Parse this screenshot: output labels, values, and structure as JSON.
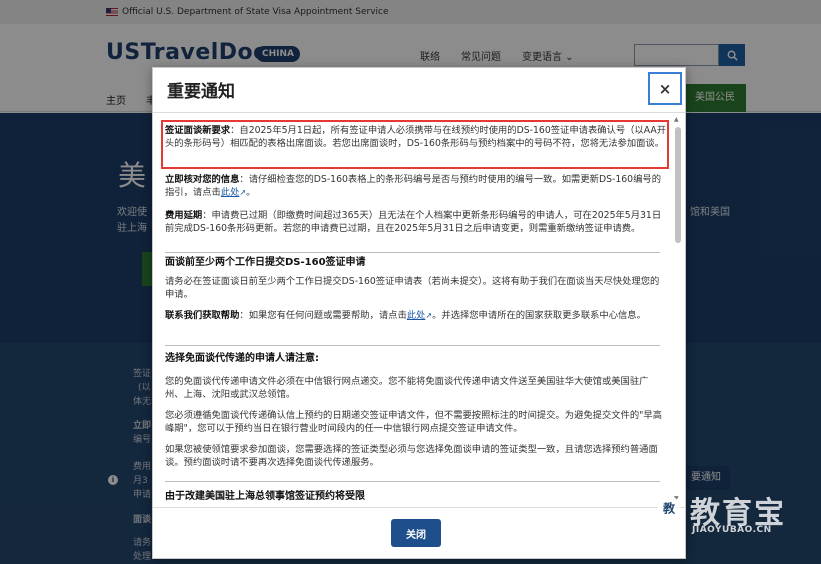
{
  "background": {
    "gov_banner": "Official U.S. Department of State Visa Appointment Service",
    "brand_name": "USTravelDocs",
    "brand_badge": "CHINA",
    "top_nav": [
      "联络",
      "常见问题",
      "变更语言 ⌄"
    ],
    "main_nav_home": "主页",
    "main_nav_partial": "丰",
    "main_nav_right": "美国公民",
    "hero_title": "美",
    "hero_left_lines": [
      "欢迎使",
      "驻上海"
    ],
    "hero_right_lines": [
      "馆和美国"
    ],
    "lower_fragments": [
      "签证",
      "(以",
      "体无",
      "立即",
      "编号",
      "费用",
      "月3",
      "申请",
      "面谈",
      "请务",
      "处理"
    ],
    "notice_button_partial": "要通知"
  },
  "modal": {
    "title": "重要通知",
    "close_label": "×",
    "paragraphs": [
      {
        "lead": "签证面谈新要求",
        "text": "：自2025年5月1日起，所有签证申请人必须携带与在线预约时使用的DS-160签证申请表确认号（以AA开头的条形码号）相匹配的表格出席面谈。若您出席面谈时，DS-160条形码与预约档案中的号码不符，您将无法参加面谈。"
      },
      {
        "lead": "立即核对您的信息",
        "text": "：请仔细检查您的DS-160表格上的条形码编号是否与预约时使用的编号一致。如需更新DS-160编号的指引，请点击",
        "link": "此处",
        "tail": "。"
      },
      {
        "lead": "费用延期",
        "text": "：申请费已过期（即缴费时间超过365天）且无法在个人档案中更新条形码编号的申请人，可在2025年5月31日前完成DS-160条形码更新。若您的申请费已过期，且在2025年5月31日之后申请变更，则需重新缴纳签证申请费。"
      }
    ],
    "section_submit_head": "面谈前至少两个工作日提交DS-160签证申请",
    "section_submit_text": "请务必在签证面谈日前至少两个工作日提交DS-160签证申请表（若尚未提交）。这将有助于我们在面谈当天尽快处理您的申请。",
    "help": {
      "lead": "联系我们获取帮助",
      "text": "：如果您有任何问题或需要帮助，请点击",
      "link": "此处",
      "tail": "。并选择您申请所在的国家获取更多联系中心信息。"
    },
    "waiver_head": "选择免面谈代传递的申请人请注意:",
    "waiver_paragraphs": [
      "您的免面谈代传递申请文件必须在中信银行网点递交。您不能将免面谈代传递申请文件送至美国驻华大使馆或美国驻广州、上海、沈阳或武汉总领馆。",
      "您必须遵循免面谈代传递确认信上预约的日期递交签证申请文件，但不需要按照标注的时间提交。为避免提交文件的\"早高峰期\"，您可以于预约当日在银行营业时间段内的任一中信银行网点提交签证申请文件。",
      "如果您被使领馆要求参加面谈，您需要选择的签证类型必须与您选择免面谈申请的签证类型一致，且请您选择预约普通面谈。预约面谈时请不要再次选择免面谈代传递服务。"
    ],
    "shanghai_head": "由于改建美国驻上海总领事馆签证预约将受限",
    "footer_button": "关闭"
  },
  "watermark": {
    "main": "教育宝",
    "sub": "JIAOYUBAO.CN"
  },
  "colors": {
    "highlight_border": "#e53935",
    "primary_button": "#1f4e8c",
    "brand_blue": "#1f3f6e",
    "link_blue": "#1a56a8",
    "nav_green": "#2e7d32"
  }
}
